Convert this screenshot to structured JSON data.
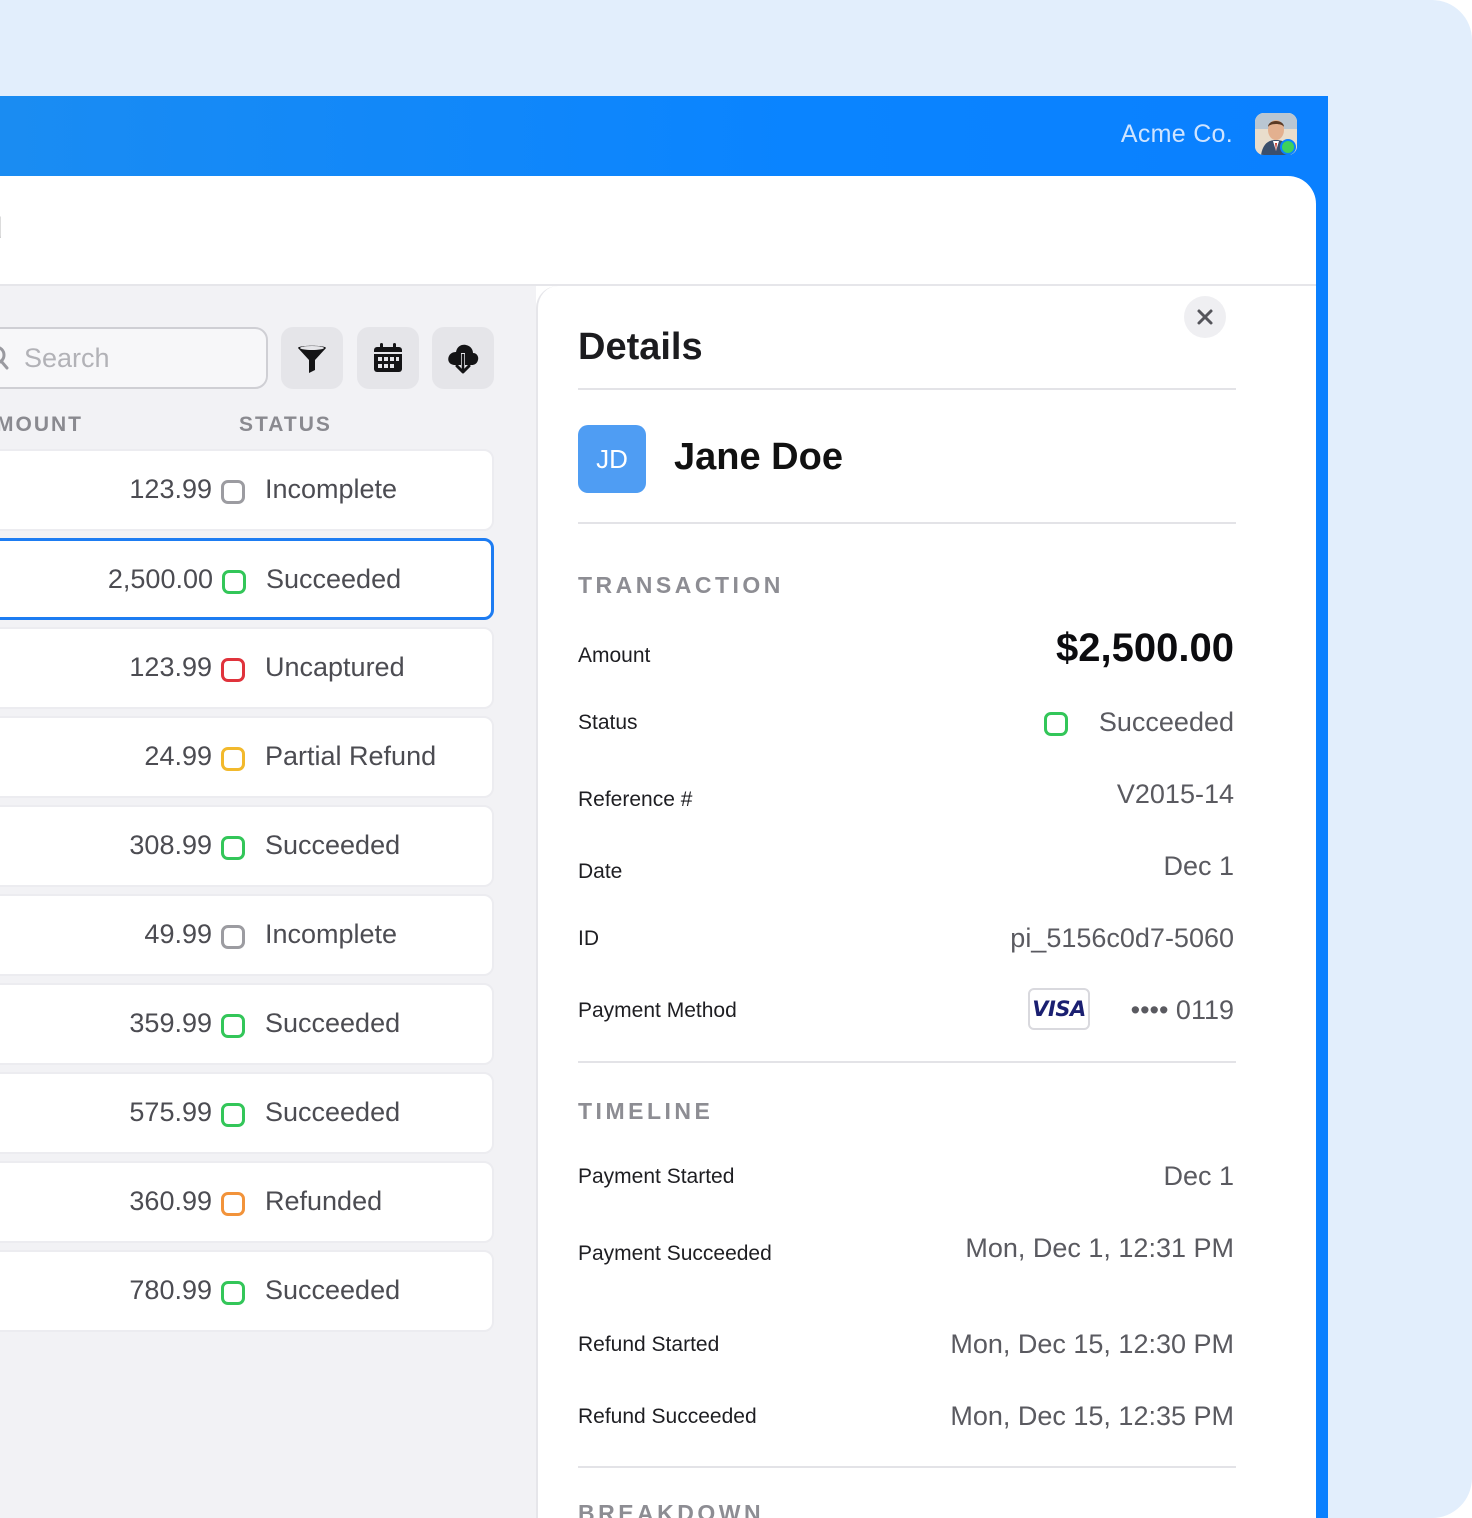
{
  "header": {
    "company": "Acme Co.",
    "panel_title_fragment": "d"
  },
  "toolbar": {
    "search_placeholder": "Search",
    "icons": [
      "search-icon",
      "filter-icon",
      "calendar-icon",
      "cloud-download-icon"
    ]
  },
  "table": {
    "columns": [
      "MOUNT",
      "STATUS"
    ],
    "rows": [
      {
        "amount": "123.99",
        "status": "Incomplete",
        "color": "#9c9ca1"
      },
      {
        "amount": "2,500.00",
        "status": "Succeeded",
        "color": "#33c659",
        "selected": true
      },
      {
        "amount": "123.99",
        "status": "Uncaptured",
        "color": "#e0333c"
      },
      {
        "amount": "24.99",
        "status": "Partial Refund",
        "color": "#f2b92c"
      },
      {
        "amount": "308.99",
        "status": "Succeeded",
        "color": "#33c659"
      },
      {
        "amount": "49.99",
        "status": "Incomplete",
        "color": "#9c9ca1"
      },
      {
        "amount": "359.99",
        "status": "Succeeded",
        "color": "#33c659"
      },
      {
        "amount": "575.99",
        "status": "Succeeded",
        "color": "#33c659"
      },
      {
        "amount": "360.99",
        "status": "Refunded",
        "color": "#f2933a"
      },
      {
        "amount": "780.99",
        "status": "Succeeded",
        "color": "#33c659"
      }
    ]
  },
  "details": {
    "title": "Details",
    "customer": {
      "initials": "JD",
      "name": "Jane Doe"
    },
    "transaction_label": "TRANSACTION",
    "transaction": {
      "amount_label": "Amount",
      "amount": "$2,500.00",
      "status_label": "Status",
      "status": "Succeeded",
      "reference_label": "Reference #",
      "reference": "V2015-14",
      "date_label": "Date",
      "date": "Dec 1",
      "id_label": "ID",
      "id": "pi_5156c0d7-5060",
      "method_label": "Payment Method",
      "card_brand": "VISA",
      "card_last4": "•••• 0119"
    },
    "timeline_label": "TIMELINE",
    "timeline": [
      {
        "label": "Payment Started",
        "value": "Dec 1"
      },
      {
        "label": "Payment Succeeded",
        "value": "Mon, Dec 1, 12:31 PM"
      },
      {
        "label": "Refund Started",
        "value": "Mon, Dec 15, 12:30 PM"
      },
      {
        "label": "Refund Succeeded",
        "value": "Mon, Dec 15, 12:35 PM"
      }
    ],
    "breakdown_label": "BREAKDOWN"
  },
  "colors": {
    "accent": "#0a84ff",
    "succeeded": "#33c659",
    "selected_border": "#1d7cf2"
  }
}
